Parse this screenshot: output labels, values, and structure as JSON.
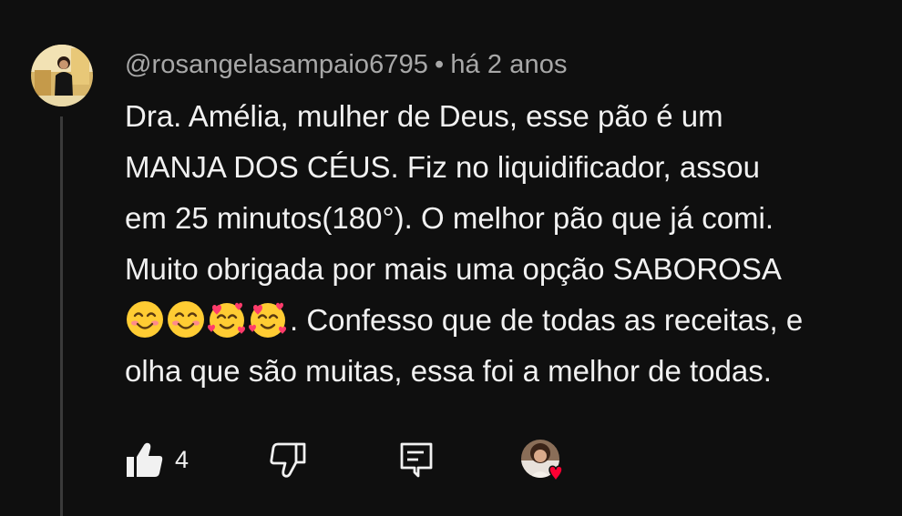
{
  "comment": {
    "username": "@rosangelasampaio6795",
    "separator": "•",
    "time": "há 2 anos",
    "lines": [
      "Dra. Amélia,  mulher de Deus, esse pão é  um",
      "MANJA DOS CÉUS. Fiz no liquidificador,  assou",
      "em 25 minutos(180°). O melhor pão que já comi.",
      "Muito obrigada por mais uma opção SABOROSA",
      ". Confesso que de todas as receitas, e",
      "olha que são muitas,  essa foi a melhor de todas."
    ],
    "emojis": [
      "smiling-face-with-smiling-eyes",
      "smiling-face-with-smiling-eyes",
      "smiling-face-with-hearts",
      "smiling-face-with-hearts"
    ]
  },
  "actions": {
    "like_count": "4",
    "like_icon": "thumb-up-icon",
    "dislike_icon": "thumb-down-icon",
    "reply_icon": "reply-icon",
    "creator_heart_icon": "creator-heart-icon"
  },
  "colors": {
    "background": "#0f0f0f",
    "text_primary": "#f1f1f1",
    "text_secondary": "#a8a8a8",
    "heart": "#ff0033"
  }
}
